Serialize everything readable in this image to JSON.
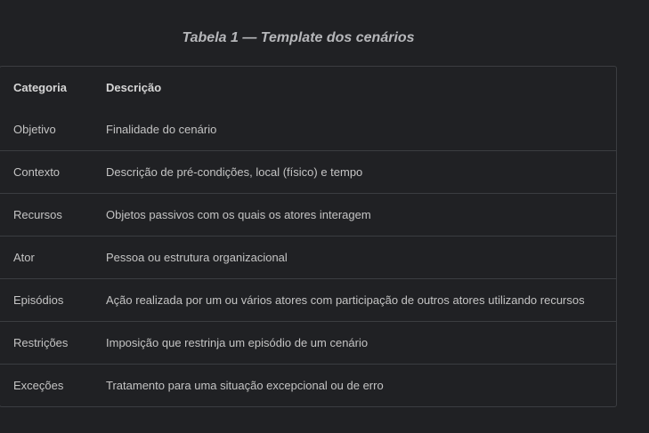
{
  "caption": "Tabela 1 — Template dos cenários",
  "table": {
    "headers": {
      "category": "Categoria",
      "description": "Descrição"
    },
    "rows": [
      {
        "category": "Objetivo",
        "description": "Finalidade do cenário"
      },
      {
        "category": "Contexto",
        "description": "Descrição de pré-condições, local (físico) e tempo"
      },
      {
        "category": "Recursos",
        "description": "Objetos passivos com os quais os atores interagem"
      },
      {
        "category": "Ator",
        "description": "Pessoa ou estrutura organizacional"
      },
      {
        "category": "Episódios",
        "description": "Ação realizada por um ou vários atores com participação de outros atores utilizando recursos"
      },
      {
        "category": "Restrições",
        "description": "Imposição que restrinja um episódio de um cenário"
      },
      {
        "category": "Exceções",
        "description": "Tratamento para uma situação excepcional ou de erro"
      }
    ]
  }
}
